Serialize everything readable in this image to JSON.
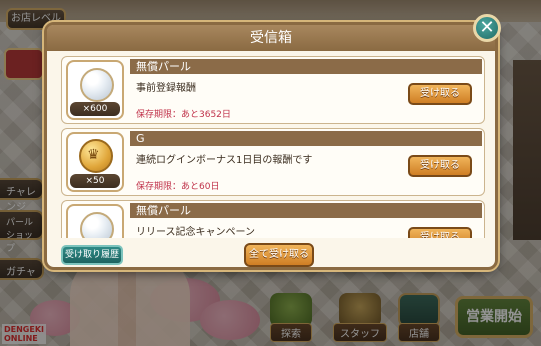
{
  "colors": {
    "dialog_border": "#8a6a42",
    "header_bg": "#a8875e",
    "claim_button": "#e09a3f",
    "history_button": "#2f8a86",
    "expire_text": "#c0324a",
    "close_button": "#2a8a84"
  },
  "background": {
    "shop_tab": "お店レベル",
    "side_menu": [
      "チャレンジ",
      "パールショップ",
      "ガチャ"
    ],
    "bottom_nav": [
      {
        "label": "探索",
        "icon": "tree-icon"
      },
      {
        "label": "スタッフ",
        "icon": "scales-icon"
      },
      {
        "label": "店舗",
        "icon": "shop-board-icon"
      }
    ],
    "start_button": "営業開始",
    "logo_line1": "DENGEKI",
    "logo_line2": "ONLINE"
  },
  "dialog": {
    "title": "受信箱",
    "close_icon": "close-icon",
    "items": [
      {
        "name": "無償パール",
        "icon": "pearl-icon",
        "quantity": "×600",
        "description": "事前登録報酬",
        "expiry": "保存期限：あと3652日",
        "claim_label": "受け取る"
      },
      {
        "name": "G",
        "icon": "gold-coin-icon",
        "icon_glyph": "♛",
        "quantity": "×50",
        "description": "連続ログインボーナス1日目の報酬です",
        "expiry": "保存期限：あと60日",
        "claim_label": "受け取る"
      },
      {
        "name": "無償パール",
        "icon": "pearl-icon",
        "quantity": "",
        "description": "リリース記念キャンペーン",
        "expiry": "",
        "claim_label": "受け取る"
      }
    ],
    "history_button": "受け取り履歴",
    "claim_all_button": "全て受け取る"
  }
}
